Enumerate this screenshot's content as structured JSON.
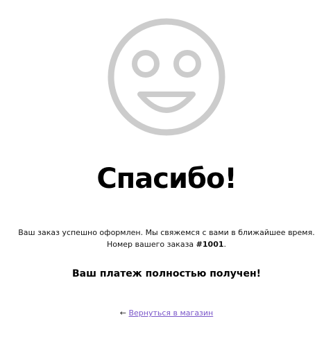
{
  "icon": {
    "name": "smiley-face-icon",
    "color": "#cccccc"
  },
  "title": "Спасибо!",
  "message": {
    "line1": "Ваш заказ успешно оформлен. Мы свяжемся с вами в ближайшее время.",
    "order_label": "Номер вашего заказа",
    "order_number": "#1001",
    "order_suffix": "."
  },
  "payment_status": "Ваш платеж полностью получен!",
  "back_link": {
    "arrow": "←",
    "label": "Вернуться в магазин",
    "color": "#7b57c9"
  }
}
